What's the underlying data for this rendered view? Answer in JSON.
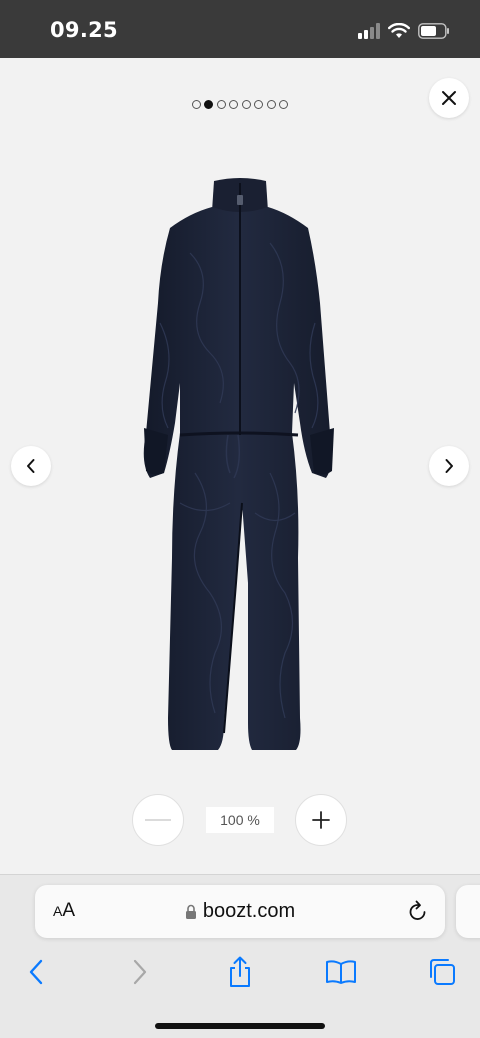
{
  "status_bar": {
    "time": "09.25",
    "icons": [
      "signal-icon",
      "wifi-icon",
      "battery-icon"
    ]
  },
  "viewer": {
    "pagination": {
      "total": 8,
      "active_index": 1
    },
    "zoom": {
      "level_label": "100 %",
      "value_percent": 100
    },
    "product_image": {
      "description_icon": "jumpsuit-image",
      "color": "#1c2336"
    },
    "icons": {
      "close": "close-icon",
      "prev": "chevron-left-icon",
      "next": "chevron-right-icon",
      "zoom_out": "minus-icon",
      "zoom_in": "plus-icon"
    }
  },
  "browser": {
    "aa_small": "A",
    "aa_large": "A",
    "url": "boozt.com",
    "accent": "#0a7aff",
    "toolbar": [
      "back-icon",
      "forward-icon",
      "share-icon",
      "bookmarks-icon",
      "tabs-icon"
    ]
  }
}
